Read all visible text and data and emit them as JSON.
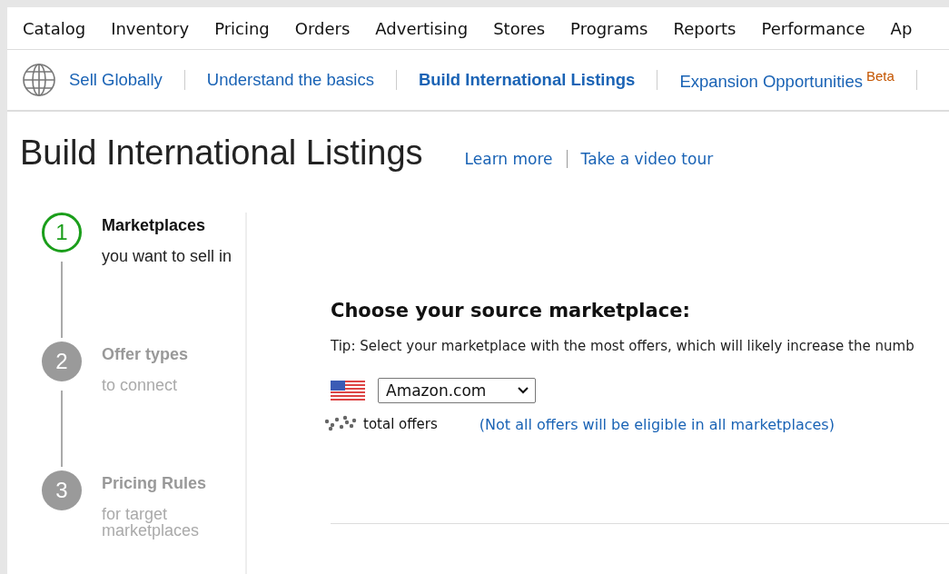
{
  "top_nav": [
    {
      "label": "Catalog"
    },
    {
      "label": "Inventory"
    },
    {
      "label": "Pricing"
    },
    {
      "label": "Orders"
    },
    {
      "label": "Advertising"
    },
    {
      "label": "Stores"
    },
    {
      "label": "Programs"
    },
    {
      "label": "Reports"
    },
    {
      "label": "Performance"
    },
    {
      "label": "Ap"
    }
  ],
  "sub_nav": [
    {
      "label": "Sell Globally",
      "selected": false
    },
    {
      "label": "Understand the basics",
      "selected": false
    },
    {
      "label": "Build International Listings",
      "selected": true
    },
    {
      "label": "Expansion Opportunities",
      "badge": "Beta",
      "selected": false
    }
  ],
  "page": {
    "title": "Build International Listings",
    "links": [
      "Learn more",
      "Take a video tour"
    ]
  },
  "steps": [
    {
      "number": "1",
      "title": "Marketplaces",
      "subtitle": "you want to sell in",
      "selected": true
    },
    {
      "number": "2",
      "title": "Offer types",
      "subtitle": "to connect",
      "selected": false
    },
    {
      "number": "3",
      "title": "Pricing Rules",
      "subtitle": "for target marketplaces",
      "selected": false
    }
  ],
  "source": {
    "heading": "Choose your source marketplace:",
    "tip": "Tip: Select your marketplace with the most offers, which will likely increase the numb",
    "marketplace": "Amazon.com",
    "offers_label": "total offers",
    "eligibility_note": "(Not all offers will be eligible in all marketplaces)"
  }
}
